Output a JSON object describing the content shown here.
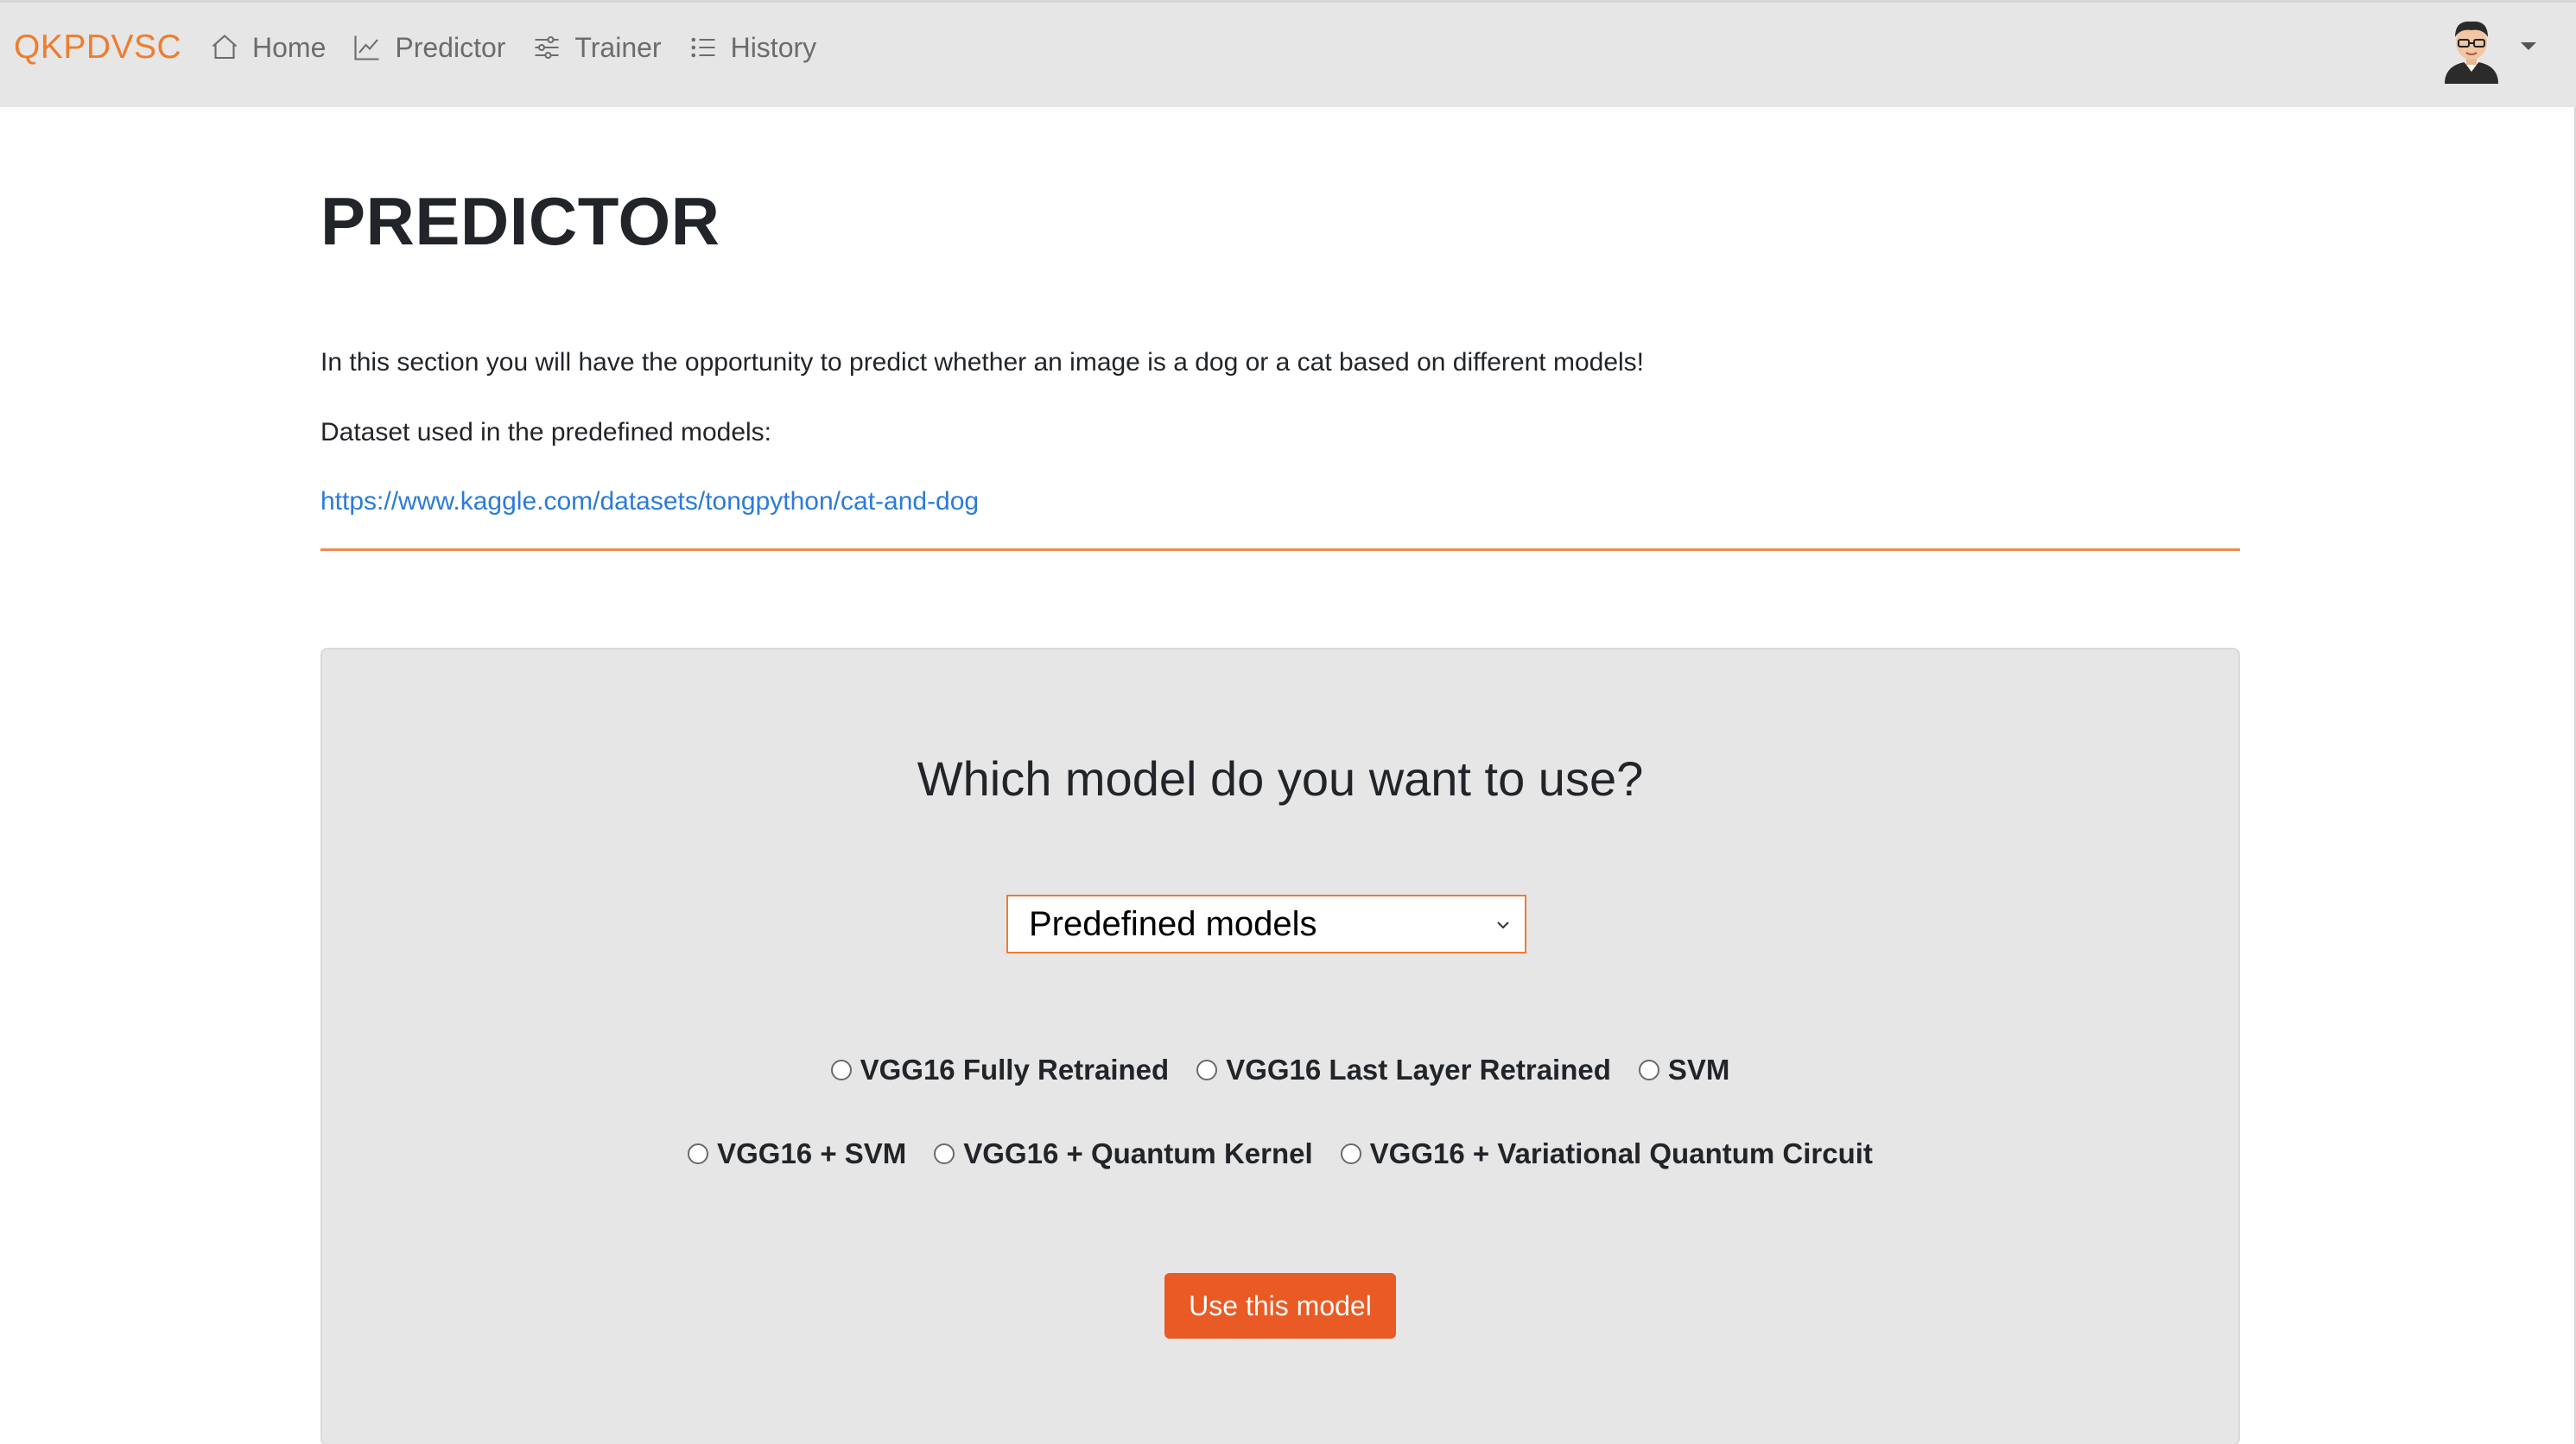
{
  "navbar": {
    "brand": "QKPDVSC",
    "links": [
      {
        "label": "Home",
        "icon": "house-icon"
      },
      {
        "label": "Predictor",
        "icon": "line-chart-icon"
      },
      {
        "label": "Trainer",
        "icon": "sliders-icon"
      },
      {
        "label": "History",
        "icon": "list-icon"
      }
    ],
    "avatar_icon": "user-avatar",
    "dropdown_icon": "caret-down-icon"
  },
  "main": {
    "title": "PREDICTOR",
    "intro": "In this section you will have the opportunity to predict whether an image is a dog or a cat based on different models!",
    "dataset_label": "Dataset used in the predefined models:",
    "dataset_link": "https://www.kaggle.com/datasets/tongpython/cat-and-dog"
  },
  "card": {
    "question": "Which model do you want to use?",
    "select": {
      "selected": "Predefined models"
    },
    "options_row1": [
      "VGG16 Fully Retrained",
      "VGG16 Last Layer Retrained",
      "SVM"
    ],
    "options_row2": [
      "VGG16 + SVM",
      "VGG16 + Quantum Kernel",
      "VGG16 + Variational Quantum Circuit"
    ],
    "button": "Use this model"
  },
  "colors": {
    "brand": "#ee7d2f",
    "link": "#2b7bd8",
    "divider": "#ee8a4f",
    "button": "#e95a24",
    "navbar_bg": "#e6e6e6",
    "card_bg": "#e6e6e6"
  }
}
